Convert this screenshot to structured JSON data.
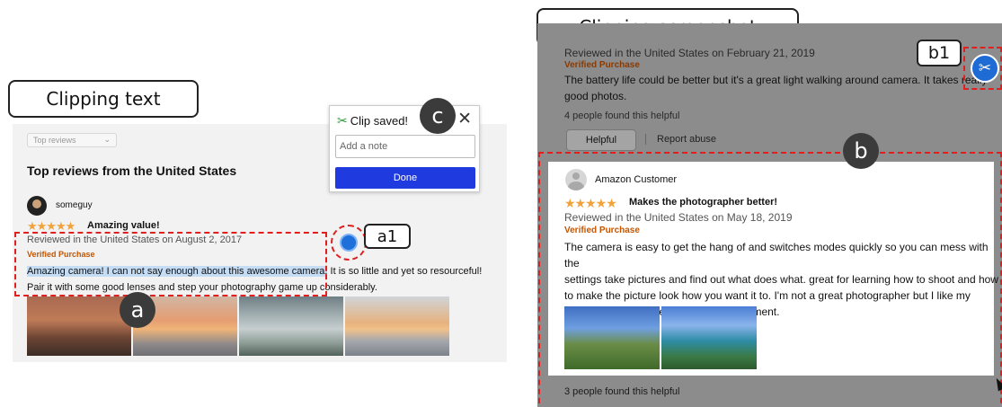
{
  "callouts": {
    "clipping_text": "Clipping text",
    "clipping_screenshot": "Clipping screenshot",
    "a": "a",
    "a1": "a1",
    "b": "b",
    "b1": "b1",
    "c": "c"
  },
  "left": {
    "dropdown": "Top reviews",
    "heading": "Top reviews from the United States",
    "username": "someguy",
    "review_title": "Amazing value!",
    "meta": "Reviewed in the United States on August 2, 2017",
    "verified": "Verified Purchase",
    "body_highlight": "Amazing camera! I can not say enough about this awesome camera.",
    "body_rest_line1": " It is so little and yet so resourceful!",
    "body_line2": "Pair it with some good lenses and step your photography game up considerably."
  },
  "popup": {
    "title": "Clip saved!",
    "close": "✕",
    "placeholder": "Add a note",
    "done": "Done"
  },
  "right": {
    "top_meta": "Reviewed in the United States on February 21, 2019",
    "top_verified": "Verified Purchase",
    "top_body_line1": "The battery life could be better but it's a great light walking around camera. It takes really",
    "top_body_line2": "good photos.",
    "top_helpful_count": "4 people found this helpful",
    "helpful_button": "Helpful",
    "report_abuse": "Report abuse",
    "customer": "Amazon Customer",
    "review_title": "Makes the photographer better!",
    "meta": "Reviewed in the United States on May 18, 2019",
    "verified": "Verified Purchase",
    "body_line1": "The camera is easy to get the hang of and switches modes quickly so you can mess with the",
    "body_line2": "settings take pictures and find out what does what. great for learning how to shoot and how",
    "body_line3": "to make the picture look how you want it to. I'm not a great photographer but I like my",
    "body_line4": "photos and the camera is half the enjoyment.",
    "bottom_helpful_count": "3 people found this helpful"
  },
  "icons": {
    "stars": "★★★★★",
    "chevron": "⌄",
    "scissors": "✂"
  },
  "colors": {
    "star": "#f2a23a",
    "verified": "#c45500",
    "done_button": "#1f3be0",
    "highlight": "#c4dcf4",
    "annotation": "#e02020"
  }
}
